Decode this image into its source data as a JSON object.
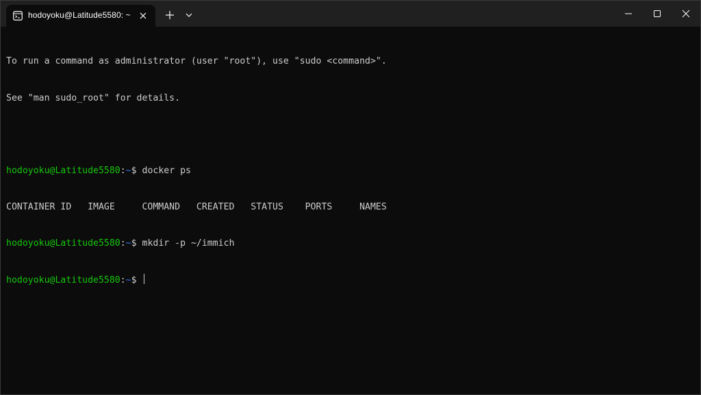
{
  "window": {
    "tab_title": "hodoyoku@Latitude5580: ~",
    "icons": {
      "tab": "terminal-icon",
      "tab_close": "close-icon",
      "new_tab": "plus-icon",
      "dropdown": "chevron-down-icon",
      "minimize": "minimize-icon",
      "maximize": "maximize-icon",
      "close": "close-icon"
    }
  },
  "colors": {
    "background": "#0c0c0c",
    "titlebar": "#202020",
    "text": "#cccccc",
    "prompt_user": "#16c60c",
    "prompt_path": "#3b78ff"
  },
  "terminal": {
    "motd_line1": "To run a command as administrator (user \"root\"), use \"sudo <command>\".",
    "motd_line2": "See \"man sudo_root\" for details.",
    "prompt_user_host": "hodoyoku@Latitude5580",
    "prompt_colon": ":",
    "prompt_path": "~",
    "prompt_symbol": "$ ",
    "commands": [
      "docker ps",
      "mkdir -p ~/immich",
      ""
    ],
    "docker_header": "CONTAINER ID   IMAGE     COMMAND   CREATED   STATUS    PORTS     NAMES"
  }
}
